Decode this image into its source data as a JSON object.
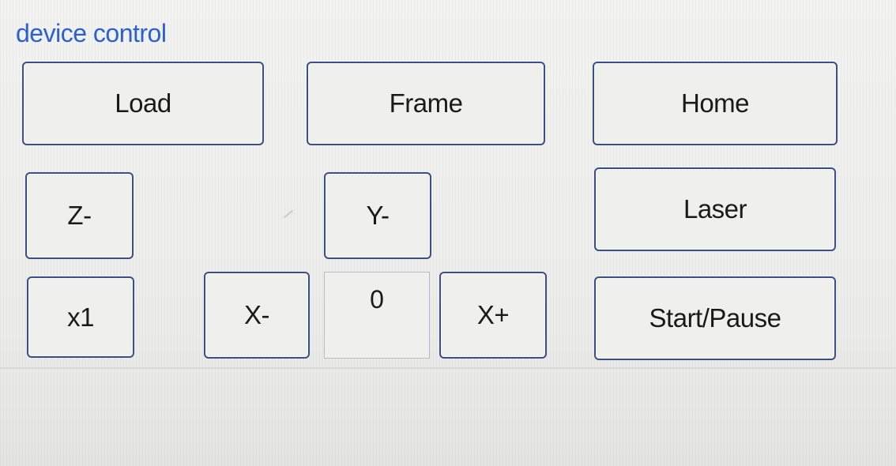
{
  "group": {
    "title": "device control"
  },
  "buttons": {
    "load": "Load",
    "frame": "Frame",
    "home": "Home",
    "z_minus": "Z-",
    "y_minus": "Y-",
    "laser": "Laser",
    "step": "x1",
    "x_minus": "X-",
    "x_plus": "X+",
    "start_pause": "Start/Pause"
  },
  "position_field": {
    "value": "0"
  }
}
